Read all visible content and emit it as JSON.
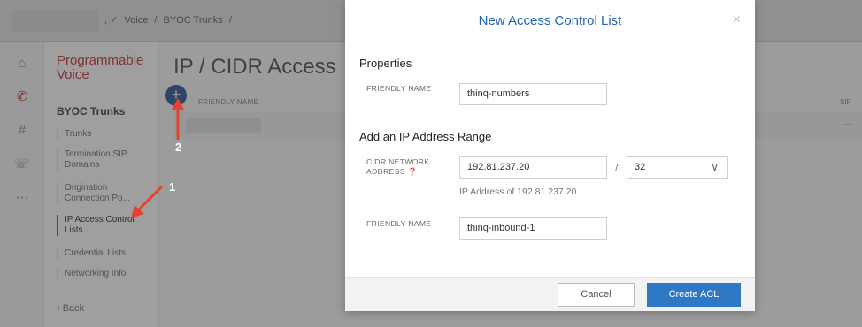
{
  "topbar": {
    "crumbs": [
      ", ✓",
      "Voice",
      "/",
      "BYOC Trunks",
      "/"
    ]
  },
  "sidebar": {
    "section_title": "Programmable Voice",
    "group_title": "BYOC Trunks",
    "items": [
      {
        "label": "Trunks"
      },
      {
        "label": "Termination SIP Domains"
      },
      {
        "label": "Origination Connection Po..."
      },
      {
        "label": "IP Access Control Lists"
      },
      {
        "label": "Credential Lists"
      },
      {
        "label": "Networking Info"
      }
    ],
    "back_label": "‹ Back"
  },
  "main": {
    "page_title": "IP / CIDR Access",
    "add_symbol": "+",
    "column_header": "FRIENDLY NAME",
    "column_header_right": "SIP",
    "row_dash": "—"
  },
  "annotations": {
    "label_1": "1",
    "label_2": "2",
    "arrow_color": "#e8422f"
  },
  "modal": {
    "title": "New Access Control List",
    "close_symbol": "×",
    "properties_title": "Properties",
    "friendly_name_label": "FRIENDLY NAME",
    "friendly_name_value": "thinq-numbers",
    "range_title": "Add an IP Address Range",
    "cidr_label": "CIDR NETWORK ADDRESS ❓",
    "cidr_value": "192.81.237.20",
    "slash": "/",
    "prefix_value": "32",
    "hint": "IP Address of 192.81.237.20",
    "range_friendly_label": "FRIENDLY NAME",
    "range_friendly_value": "thinq-inbound-1",
    "cancel_label": "Cancel",
    "create_label": "Create ACL"
  },
  "colors": {
    "accent_blue": "#2f78c4",
    "brand_red": "#c12a2a"
  }
}
